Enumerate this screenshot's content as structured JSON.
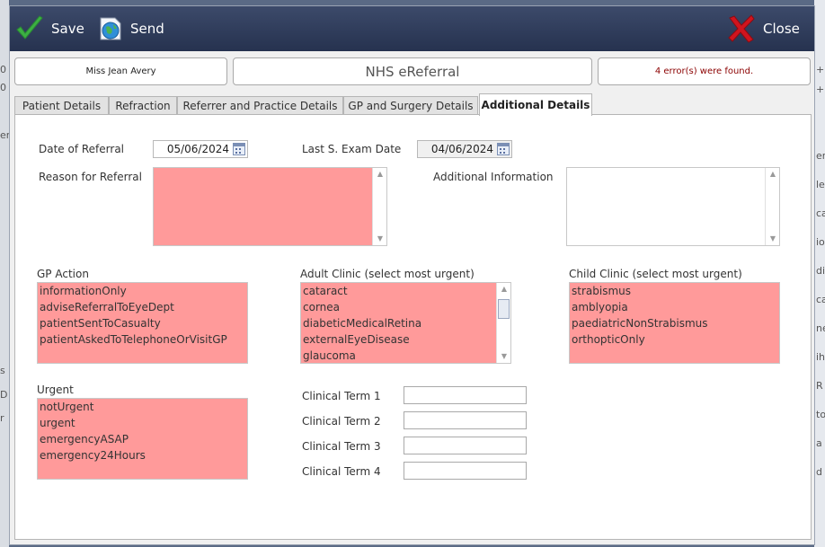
{
  "toolbar": {
    "save_label": "Save",
    "send_label": "Send",
    "close_label": "Close"
  },
  "header": {
    "patient_name": "Miss Jean Avery",
    "title": "NHS eReferral",
    "error_message": "4 error(s) were found."
  },
  "tabs": [
    {
      "label": "Patient Details",
      "active": false
    },
    {
      "label": "Refraction",
      "active": false
    },
    {
      "label": "Referrer and Practice Details",
      "active": false
    },
    {
      "label": "GP and Surgery Details",
      "active": false
    },
    {
      "label": "Additional Details",
      "active": true
    }
  ],
  "form": {
    "date_of_referral_label": "Date of Referral",
    "date_of_referral_value": "05/06/2024",
    "last_exam_label": "Last S. Exam Date",
    "last_exam_value": "04/06/2024",
    "reason_label": "Reason for Referral",
    "additional_info_label": "Additional Information",
    "gp_action": {
      "label": "GP Action",
      "options": [
        "informationOnly",
        "adviseReferralToEyeDept",
        "patientSentToCasualty",
        "patientAskedToTelephoneOrVisitGP"
      ]
    },
    "adult_clinic": {
      "label": "Adult Clinic (select most urgent)",
      "options": [
        "cataract",
        "cornea",
        "diabeticMedicalRetina",
        "externalEyeDisease",
        "glaucoma"
      ]
    },
    "child_clinic": {
      "label": "Child Clinic (select most urgent)",
      "options": [
        "strabismus",
        "amblyopia",
        "paediatricNonStrabismus",
        "orthopticOnly"
      ]
    },
    "urgent": {
      "label": "Urgent",
      "options": [
        "notUrgent",
        "urgent",
        "emergencyASAP",
        "emergency24Hours"
      ]
    },
    "clinical_terms": [
      {
        "label": "Clinical Term 1",
        "value": ""
      },
      {
        "label": "Clinical Term 2",
        "value": ""
      },
      {
        "label": "Clinical Term 3",
        "value": ""
      },
      {
        "label": "Clinical Term 4",
        "value": ""
      }
    ]
  },
  "background_fragments": {
    "left": [
      "0",
      "0",
      "er",
      "s",
      "D",
      "r"
    ],
    "right": [
      "+",
      "+",
      "er",
      "le",
      "ca",
      "io",
      "di",
      "ca",
      "ne",
      "ih",
      "R",
      "to",
      "a",
      "d"
    ]
  },
  "colors": {
    "toolbar_top": "#3c4a6a",
    "toolbar_bottom": "#26324f",
    "error_field": "#ff9a9a",
    "error_text": "#8b0000",
    "save_check": "#3cb043",
    "close_x": "#d0141e"
  },
  "icons": {
    "save": "green-checkmark-icon",
    "send": "globe-icon",
    "close": "red-x-icon",
    "calendar": "calendar-icon"
  }
}
